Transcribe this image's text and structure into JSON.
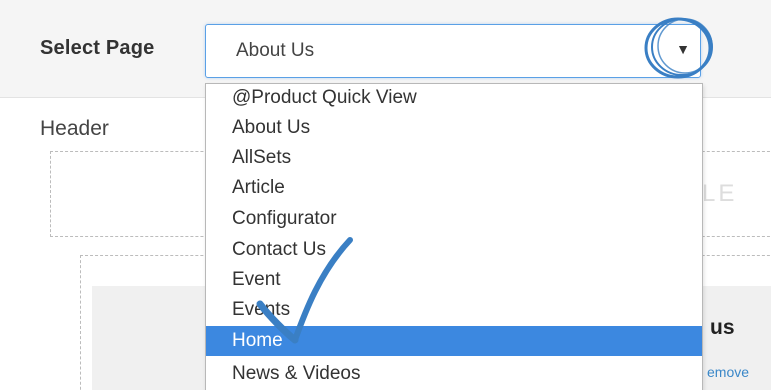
{
  "header_bar": {
    "select_label": "Select Page",
    "selected_value": "About Us",
    "arrow_glyph": "▼"
  },
  "dropdown": {
    "options": [
      "@Product Quick View",
      "About Us",
      "AllSets",
      "Article",
      "Configurator",
      "Contact Us",
      "Event",
      "Events",
      "Home",
      "News & Videos"
    ],
    "highlighted": "Home",
    "highlight_color": "#3c88e0"
  },
  "background": {
    "header_label": "Header",
    "faint_text": "LE",
    "partial_heading": "us",
    "partial_link": "emove"
  },
  "annotations": {
    "circle_color": "#3a7fc4",
    "checkmark_color": "#3a7fc4",
    "circle_icon": "circle-annotation",
    "check_icon": "checkmark-annotation"
  }
}
